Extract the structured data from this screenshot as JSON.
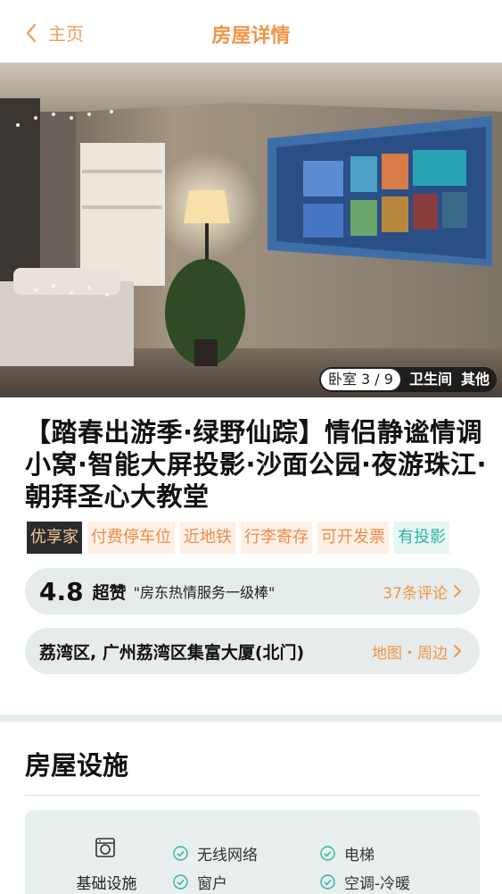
{
  "header": {
    "back_label": "主页",
    "title": "房屋详情"
  },
  "photo": {
    "active_tab": "卧室 3 / 9",
    "tabs": [
      "卫生间",
      "其他"
    ]
  },
  "listing": {
    "title": "【踏春出游季·绿野仙踪】情侣静谧情调小窝·智能大屏投影·沙面公园·夜游珠江·朝拜圣心大教堂",
    "tags": [
      {
        "label": "优享家",
        "style": "dark"
      },
      {
        "label": "付费停车位",
        "style": "orange"
      },
      {
        "label": "近地铁",
        "style": "orange"
      },
      {
        "label": "行李寄存",
        "style": "orange"
      },
      {
        "label": "可开发票",
        "style": "orange"
      },
      {
        "label": "有投影",
        "style": "teal"
      }
    ]
  },
  "rating": {
    "score": "4.8",
    "word": "超赞",
    "quote": "\"房东热情服务一级棒\"",
    "reviews_link": "37条评论"
  },
  "address": {
    "text": "荔湾区, 广州荔湾区集富大厦(北门)",
    "map_link": "地图・周边"
  },
  "facilities": {
    "section_title": "房屋设施",
    "category_label": "基础设施",
    "category_icon": "washing-machine-icon",
    "items": [
      "无线网络",
      "电梯",
      "窗户",
      "空调-冷暖"
    ]
  },
  "colors": {
    "accent": "#f29447",
    "teal": "#2cb7a1",
    "pill_bg": "#e6ebeb"
  }
}
